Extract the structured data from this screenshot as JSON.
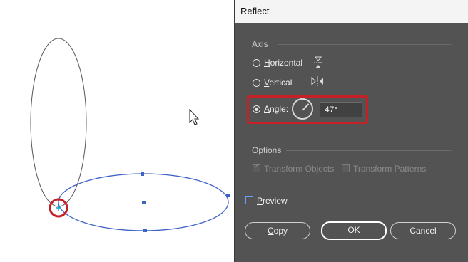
{
  "dialog": {
    "title": "Reflect",
    "axis_label": "Axis",
    "options": [
      {
        "prefix": "",
        "mnemonic": "H",
        "rest": "orizontal",
        "selected": false,
        "icon": "reflect-horizontal-icon"
      },
      {
        "prefix": "",
        "mnemonic": "V",
        "rest": "ertical",
        "selected": false,
        "icon": "reflect-vertical-icon"
      },
      {
        "prefix": "",
        "mnemonic": "A",
        "rest": "ngle:",
        "selected": true,
        "icon": "angle-dial-icon"
      }
    ],
    "angle_value": "47°",
    "options_label": "Options",
    "transform_objects": {
      "label": "Transform Objects",
      "checked": true,
      "enabled": false
    },
    "transform_patterns": {
      "label": "Transform Patterns",
      "checked": false,
      "enabled": false
    },
    "preview": {
      "mnemonic": "P",
      "rest": "review",
      "checked": false
    },
    "buttons": {
      "copy_mnemonic": "C",
      "copy_rest": "opy",
      "ok": "OK",
      "cancel": "Cancel"
    }
  },
  "colors": {
    "dialog_bg": "#535353",
    "highlight": "#c62026",
    "selection": "#3f64c8",
    "shape_stroke": "#555555"
  }
}
